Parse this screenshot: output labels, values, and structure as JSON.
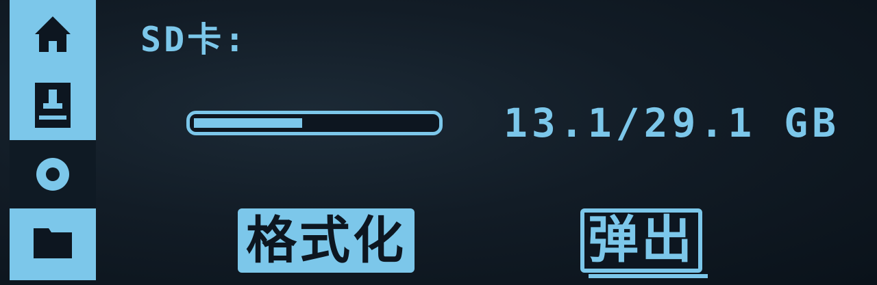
{
  "sidebar": {
    "items": [
      {
        "icon": "home-icon",
        "selected": true
      },
      {
        "icon": "sd-card-icon",
        "selected": true
      },
      {
        "icon": "settings-icon",
        "selected": false
      },
      {
        "icon": "folder-icon",
        "selected": true
      }
    ]
  },
  "sd": {
    "title": "SD卡:",
    "usage_text": "13.1/29.1 GB",
    "used_fraction": 0.45
  },
  "buttons": {
    "format_label": "格式化",
    "eject_label": "弹出"
  },
  "colors": {
    "accent": "#7cc7ea",
    "background": "#0d1620"
  }
}
